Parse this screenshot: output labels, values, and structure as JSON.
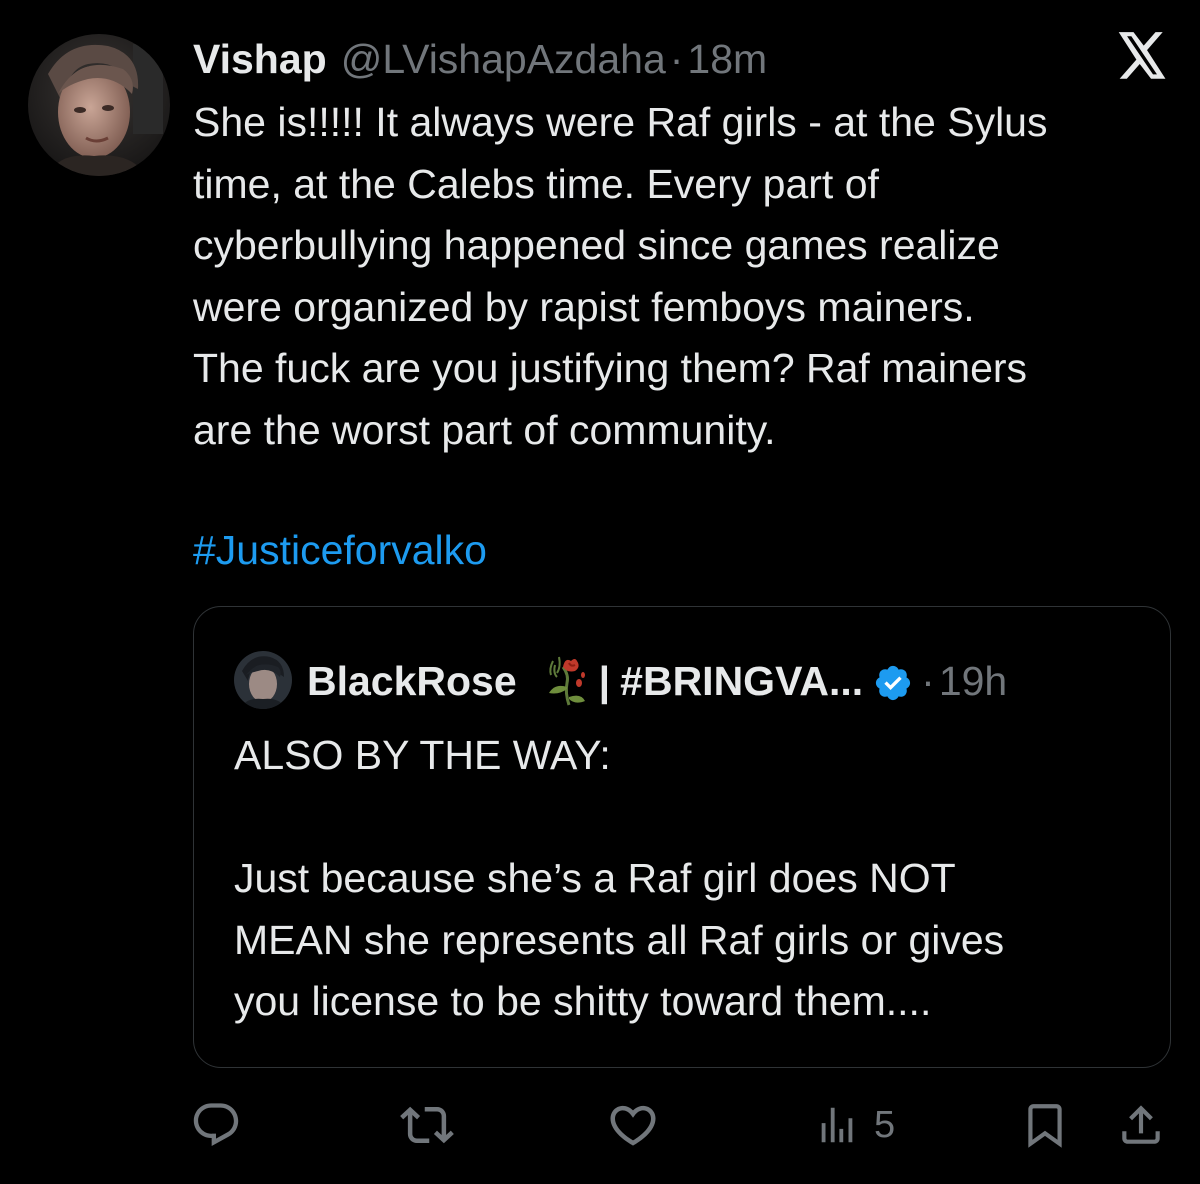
{
  "tweet": {
    "author": {
      "display_name": "Vishap",
      "handle": "@LVishapAzdaha",
      "time_separator": "·",
      "time": "18m"
    },
    "body_lines": [
      "She is!!!!! It always were Raf girls - at the Sylus",
      "time, at the Calebs time. Every part of",
      "cyberbullying happened since games realize",
      "were organized by rapist femboys mainers.",
      "The fuck are you justifying them? Raf mainers",
      "are the worst part of community."
    ],
    "hashtag": "#Justiceforvalko"
  },
  "quote": {
    "author": {
      "display_name": "BlackRose",
      "separator": "|",
      "tag": "#BRINGVA...",
      "time_separator": "·",
      "time": "19h"
    },
    "body_lines": [
      "ALSO BY THE WAY:",
      "",
      "Just because she’s a Raf girl does NOT",
      "MEAN she represents all Raf girls or gives",
      "you license to be shitty toward them...."
    ]
  },
  "actions": {
    "views_count": "5"
  },
  "icons": {
    "platform": "x-logo-icon",
    "reply": "reply-icon",
    "repost": "repost-icon",
    "like": "heart-icon",
    "views": "views-icon",
    "bookmark": "bookmark-icon",
    "share": "share-icon",
    "verified": "verified-badge-icon",
    "emoji": "wilted-rose-icon"
  },
  "colors": {
    "background": "#000000",
    "text": "#e7e9ea",
    "secondary": "#71767b",
    "link": "#1d9bf0",
    "border": "#2f3336",
    "verified": "#1d9bf0"
  }
}
